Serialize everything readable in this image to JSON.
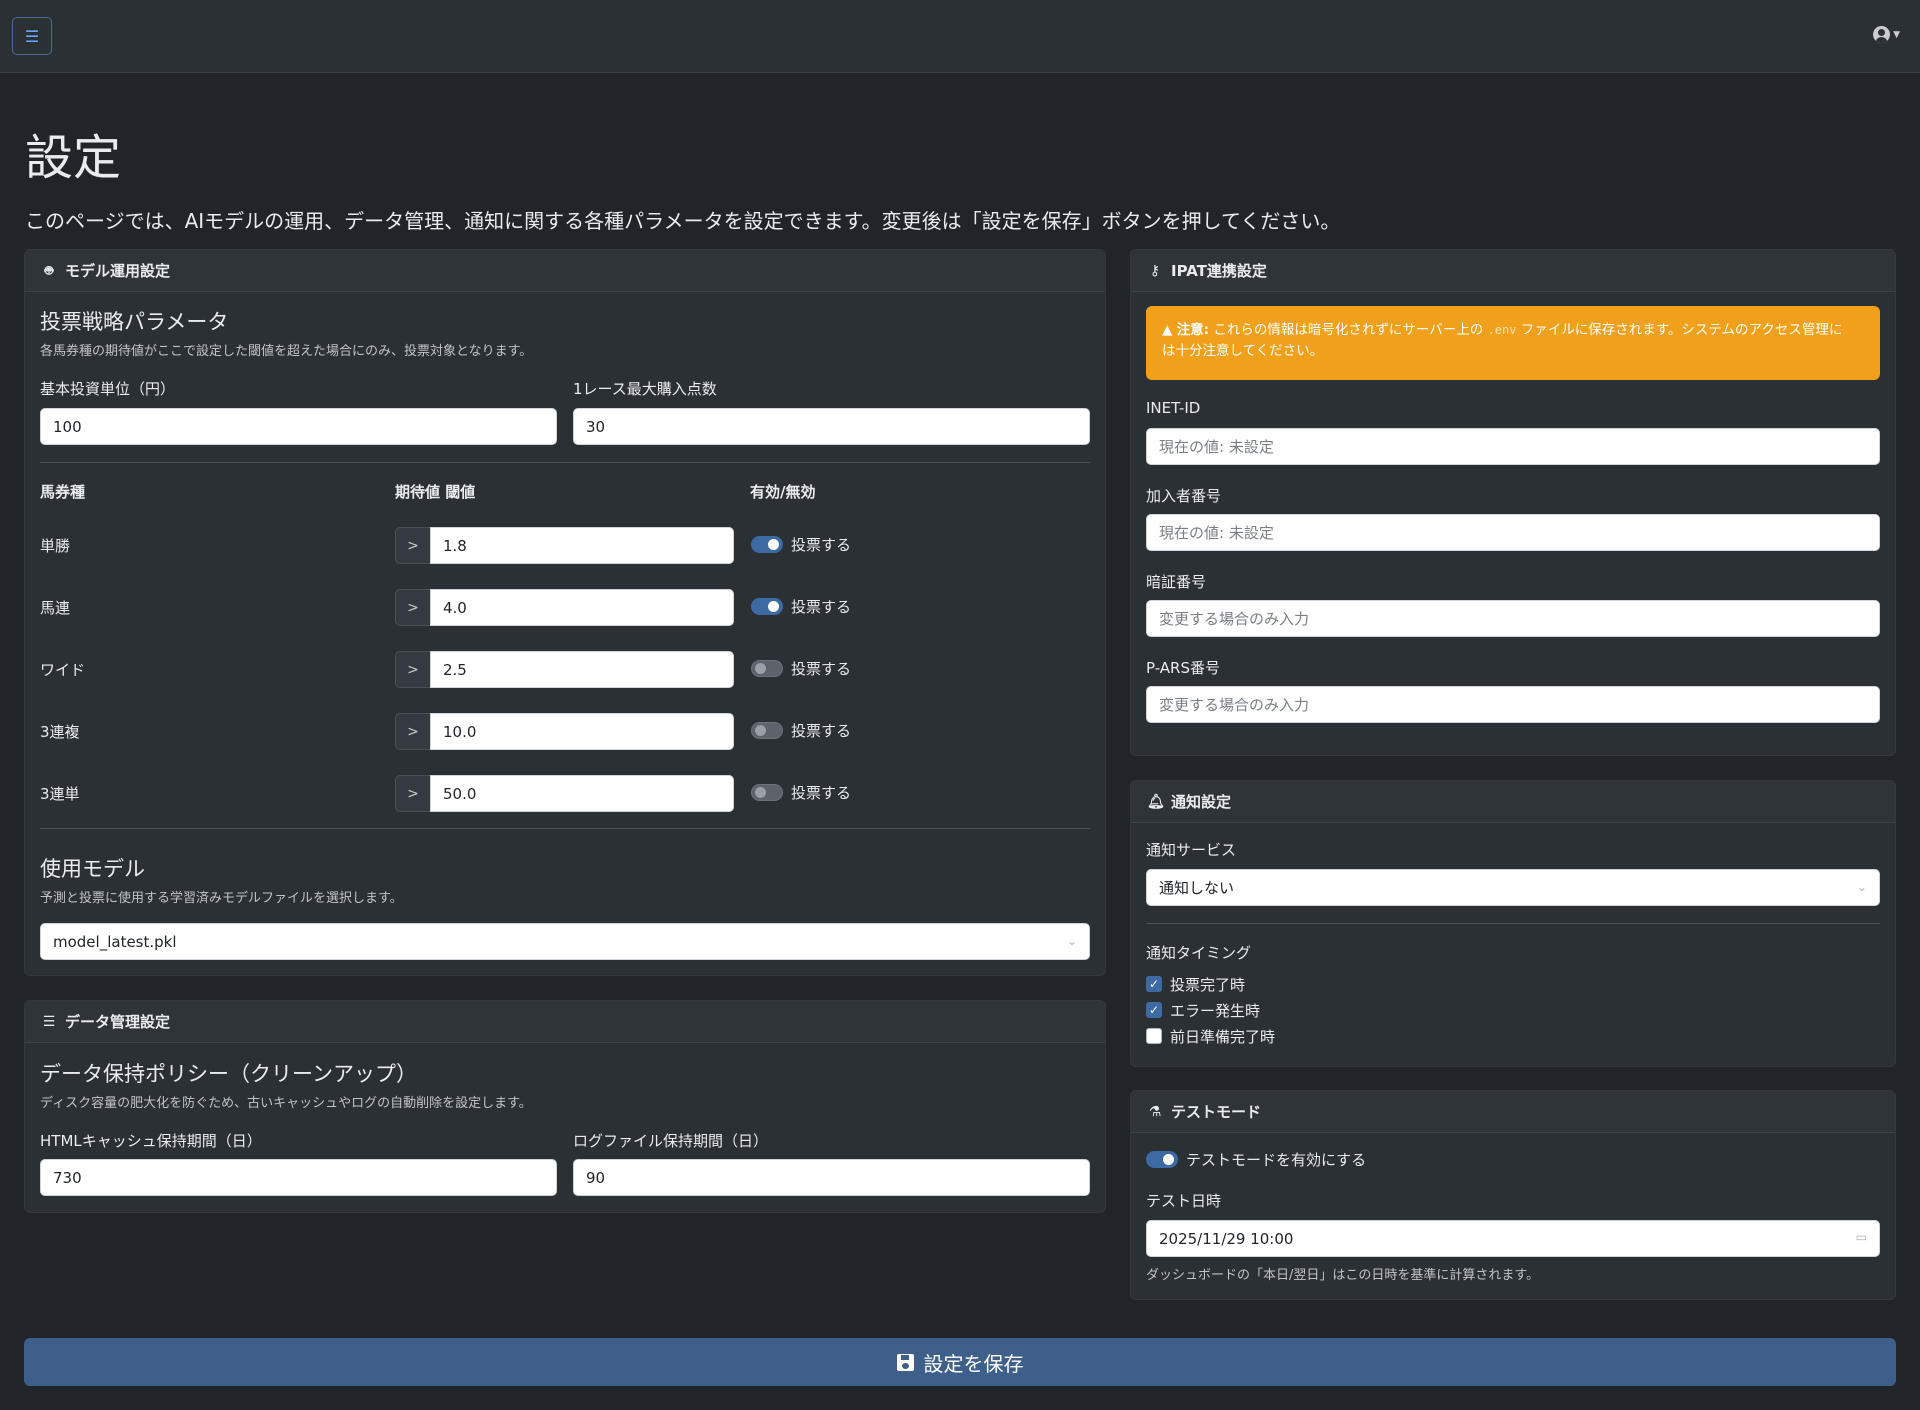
{
  "navbar": {
    "toggle_icon": "hamburger-icon",
    "user_icon": "user-circle-icon",
    "caret": "▾"
  },
  "page": {
    "title": "設定",
    "description": "このページでは、AIモデルの運用、データ管理、通知に関する各種パラメータを設定できます。変更後は「設定を保存」ボタンを押してください。"
  },
  "model_card": {
    "header": "モデル運用設定",
    "icon": "robot-icon",
    "strategy_title": "投票戦略パラメータ",
    "strategy_desc": "各馬券種の期待値がここで設定した閾値を超えた場合にのみ、投票対象となります。",
    "base_unit_label": "基本投資単位（円）",
    "base_unit_value": "100",
    "max_points_label": "1レース最大購入点数",
    "max_points_value": "30",
    "col_bet_type": "馬券種",
    "col_threshold": "期待値 閾値",
    "col_enabled": "有効/無効",
    "prefix": ">",
    "rows": [
      {
        "type": "単勝",
        "threshold": "1.8",
        "enabled": true,
        "label": "投票する"
      },
      {
        "type": "馬連",
        "threshold": "4.0",
        "enabled": true,
        "label": "投票する"
      },
      {
        "type": "ワイド",
        "threshold": "2.5",
        "enabled": false,
        "label": "投票する"
      },
      {
        "type": "3連複",
        "threshold": "10.0",
        "enabled": false,
        "label": "投票する"
      },
      {
        "type": "3連単",
        "threshold": "50.0",
        "enabled": false,
        "label": "投票する"
      }
    ],
    "model_title": "使用モデル",
    "model_desc": "予測と投票に使用する学習済みモデルファイルを選択します。",
    "model_value": "model_latest.pkl"
  },
  "data_card": {
    "header": "データ管理設定",
    "icon": "database-icon",
    "policy_title": "データ保持ポリシー（クリーンアップ）",
    "policy_desc": "ディスク容量の肥大化を防ぐため、古いキャッシュやログの自動削除を設定します。",
    "html_cache_label": "HTMLキャッシュ保持期間（日）",
    "html_cache_value": "730",
    "log_label": "ログファイル保持期間（日）",
    "log_value": "90"
  },
  "ipat_card": {
    "header": "IPAT連携設定",
    "icon": "key-icon",
    "alert_bold": "注意:",
    "alert_text_1": "これらの情報は暗号化されずにサーバー上の",
    "alert_code": ".env",
    "alert_text_2": "ファイルに保存されます。システムのアクセス管理に",
    "alert_text_3": "は十分注意してください。",
    "inet_label": "INET-ID",
    "inet_placeholder": "現在の値: 未設定",
    "member_label": "加入者番号",
    "member_placeholder": "現在の値: 未設定",
    "pin_label": "暗証番号",
    "pin_placeholder": "変更する場合のみ入力",
    "pars_label": "P-ARS番号",
    "pars_placeholder": "変更する場合のみ入力"
  },
  "notify_card": {
    "header": "通知設定",
    "icon": "bell-icon",
    "service_label": "通知サービス",
    "service_value": "通知しない",
    "timing_label": "通知タイミング",
    "timings": [
      {
        "label": "投票完了時",
        "checked": true
      },
      {
        "label": "エラー発生時",
        "checked": true
      },
      {
        "label": "前日準備完了時",
        "checked": false
      }
    ]
  },
  "test_card": {
    "header": "テストモード",
    "icon": "flask-icon",
    "toggle_label": "テストモードを有効にする",
    "toggle_on": true,
    "datetime_label": "テスト日時",
    "datetime_value": "2025/11/29 10:00",
    "datetime_help": "ダッシュボードの「本日/翌日」はこの日時を基準に計算されます。"
  },
  "save_button": {
    "label": "設定を保存",
    "icon": "floppy-icon"
  },
  "colors": {
    "background": "#212529",
    "card": "#2b3035",
    "accent": "#3d6aa3",
    "warning": "#f0a01b",
    "save": "#3d5f8a"
  }
}
